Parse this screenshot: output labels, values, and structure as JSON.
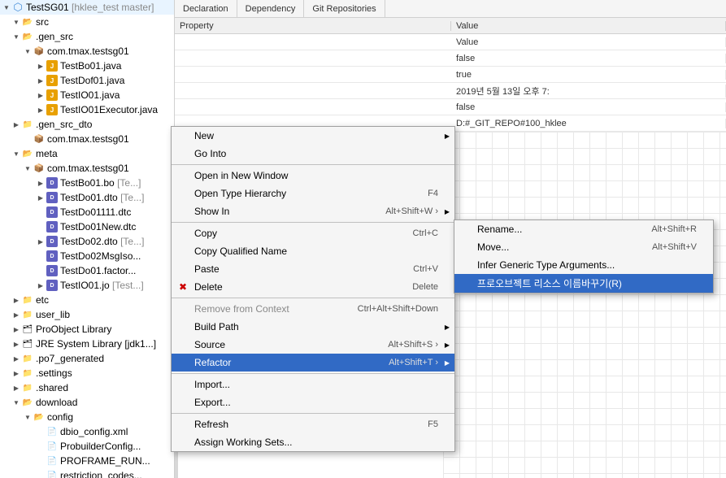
{
  "app": {
    "title": "TestSG01"
  },
  "filetree": {
    "items": [
      {
        "id": "testsg01",
        "label": "TestSG01",
        "extra": "[hklee_test master]",
        "level": 0,
        "type": "project",
        "expanded": true
      },
      {
        "id": "src",
        "label": "src",
        "level": 1,
        "type": "src",
        "expanded": true
      },
      {
        "id": "gen_src",
        "label": ".gen_src",
        "level": 1,
        "type": "src",
        "expanded": true
      },
      {
        "id": "com_tmax_testsg01",
        "label": "com.tmax.testsg01",
        "level": 2,
        "type": "package",
        "expanded": true
      },
      {
        "id": "TestBo01",
        "label": "TestBo01.java",
        "level": 3,
        "type": "java"
      },
      {
        "id": "TestDof01",
        "label": "TestDof01.java",
        "level": 3,
        "type": "java"
      },
      {
        "id": "TestIO01",
        "label": "TestIO01.java",
        "level": 3,
        "type": "java"
      },
      {
        "id": "TestIO01Executor",
        "label": "TestIO01Executor.java",
        "level": 3,
        "type": "java"
      },
      {
        "id": "gen_src_dto",
        "label": ".gen_src_dto",
        "level": 1,
        "type": "src",
        "expanded": false
      },
      {
        "id": "com_tmax_testsg01_2",
        "label": "com.tmax.testsg01",
        "level": 2,
        "type": "package"
      },
      {
        "id": "meta",
        "label": "meta",
        "level": 1,
        "type": "folder",
        "expanded": true
      },
      {
        "id": "com_tmax_testsg01_meta",
        "label": "com.tmax.testsg01",
        "level": 2,
        "type": "package",
        "expanded": true
      },
      {
        "id": "TestBo01bo",
        "label": "TestBo01.bo",
        "extra": "[Te...]",
        "level": 3,
        "type": "dto"
      },
      {
        "id": "TestDo01dto",
        "label": "TestDo01.dto",
        "extra": "[Te...]",
        "level": 3,
        "type": "dto"
      },
      {
        "id": "TestDo01111dtc",
        "label": "TestDo01111.dtc",
        "level": 3,
        "type": "dto"
      },
      {
        "id": "TestDo01New",
        "label": "TestDo01New.dtc",
        "level": 3,
        "type": "dto"
      },
      {
        "id": "TestDo02dto",
        "label": "TestDo02.dto",
        "extra": "[Te...]",
        "level": 3,
        "type": "dto"
      },
      {
        "id": "TestDo02MsgIso",
        "label": "TestDo02MsgIso...",
        "level": 3,
        "type": "dto"
      },
      {
        "id": "TestDo01factor",
        "label": "TestDo01.factor...",
        "level": 3,
        "type": "dto"
      },
      {
        "id": "TestIO01jo",
        "label": "TestIO01.jo",
        "extra": "[Test...]",
        "level": 3,
        "type": "dto"
      },
      {
        "id": "etc",
        "label": "etc",
        "level": 1,
        "type": "folder"
      },
      {
        "id": "user_lib",
        "label": "user_lib",
        "level": 1,
        "type": "folder"
      },
      {
        "id": "ProObjectLibrary",
        "label": "ProObject Library",
        "level": 1,
        "type": "lib"
      },
      {
        "id": "JRESystemLibrary",
        "label": "JRE System Library [jdk1...]",
        "level": 1,
        "type": "lib"
      },
      {
        "id": "po7_generated",
        "label": ".po7_generated",
        "level": 1,
        "type": "folder"
      },
      {
        "id": "settings",
        "label": ".settings",
        "level": 1,
        "type": "folder"
      },
      {
        "id": "shared",
        "label": ".shared",
        "level": 1,
        "type": "folder"
      },
      {
        "id": "download",
        "label": "download",
        "level": 1,
        "type": "folder",
        "expanded": true
      },
      {
        "id": "config",
        "label": "config",
        "level": 2,
        "type": "folder",
        "expanded": true
      },
      {
        "id": "dbio_config",
        "label": "dbio_config.xml",
        "level": 3,
        "type": "xml"
      },
      {
        "id": "ProbuilderConfig",
        "label": "ProbuilderConfig...",
        "level": 3,
        "type": "xml"
      },
      {
        "id": "PROFRAME_RUN",
        "label": "PROFRAME_RUN...",
        "level": 3,
        "type": "xml"
      },
      {
        "id": "restriction_codes",
        "label": "restriction_codes...",
        "level": 3,
        "type": "xml"
      }
    ]
  },
  "tabs": [
    {
      "id": "declaration",
      "label": "Declaration"
    },
    {
      "id": "dependency",
      "label": "Dependency"
    },
    {
      "id": "git_repositories",
      "label": "Git Repositories"
    }
  ],
  "properties": {
    "header": [
      "Property",
      "Value"
    ],
    "rows": [
      {
        "property": "",
        "value": "Value"
      },
      {
        "property": "",
        "value": "false"
      },
      {
        "property": "",
        "value": "true"
      },
      {
        "property": "",
        "value": "2019년 5월 13일 오후 7:"
      },
      {
        "property": "",
        "value": "false"
      },
      {
        "property": "",
        "value": "D:#_GIT_REPO#100_hklee"
      }
    ]
  },
  "contextmenu": {
    "items": [
      {
        "id": "new",
        "label": "New",
        "shortcut": "",
        "hasSubmenu": true,
        "separator_after": false
      },
      {
        "id": "go_into",
        "label": "Go Into",
        "shortcut": "",
        "hasSubmenu": false,
        "separator_after": false
      },
      {
        "id": "sep1",
        "type": "separator"
      },
      {
        "id": "open_new_window",
        "label": "Open in New Window",
        "shortcut": "",
        "hasSubmenu": false
      },
      {
        "id": "open_type_hierarchy",
        "label": "Open Type Hierarchy",
        "shortcut": "F4",
        "hasSubmenu": false
      },
      {
        "id": "show_in",
        "label": "Show In",
        "shortcut": "Alt+Shift+W",
        "hasSubmenu": true
      },
      {
        "id": "sep2",
        "type": "separator"
      },
      {
        "id": "copy",
        "label": "Copy",
        "shortcut": "Ctrl+C",
        "hasSubmenu": false
      },
      {
        "id": "copy_qualified",
        "label": "Copy Qualified Name",
        "shortcut": "",
        "hasSubmenu": false
      },
      {
        "id": "paste",
        "label": "Paste",
        "shortcut": "Ctrl+V",
        "hasSubmenu": false
      },
      {
        "id": "delete",
        "label": "Delete",
        "shortcut": "Delete",
        "hasSubmenu": false
      },
      {
        "id": "sep3",
        "type": "separator"
      },
      {
        "id": "remove_context",
        "label": "Remove from Context",
        "shortcut": "Ctrl+Alt+Shift+Down",
        "hasSubmenu": false,
        "disabled": true
      },
      {
        "id": "build_path",
        "label": "Build Path",
        "shortcut": "",
        "hasSubmenu": true
      },
      {
        "id": "source",
        "label": "Source",
        "shortcut": "Alt+Shift+S",
        "hasSubmenu": true
      },
      {
        "id": "refactor",
        "label": "Refactor",
        "shortcut": "Alt+Shift+T",
        "hasSubmenu": true,
        "highlighted": true
      },
      {
        "id": "sep4",
        "type": "separator"
      },
      {
        "id": "import",
        "label": "Import...",
        "shortcut": "",
        "hasSubmenu": false
      },
      {
        "id": "export",
        "label": "Export...",
        "shortcut": "",
        "hasSubmenu": false
      },
      {
        "id": "sep5",
        "type": "separator"
      },
      {
        "id": "refresh",
        "label": "Refresh",
        "shortcut": "F5",
        "hasSubmenu": false
      },
      {
        "id": "assign_working_sets",
        "label": "Assign Working Sets...",
        "shortcut": "",
        "hasSubmenu": false
      }
    ]
  },
  "submenu": {
    "items": [
      {
        "id": "rename",
        "label": "Rename...",
        "shortcut": "Alt+Shift+R"
      },
      {
        "id": "move",
        "label": "Move...",
        "shortcut": "Alt+Shift+V"
      },
      {
        "id": "infer_generic",
        "label": "Infer Generic Type Arguments...",
        "shortcut": ""
      },
      {
        "id": "proo_rename",
        "label": "프로오브젝트 리소스 이름바꾸기(R)",
        "shortcut": "",
        "highlighted": true
      }
    ]
  }
}
